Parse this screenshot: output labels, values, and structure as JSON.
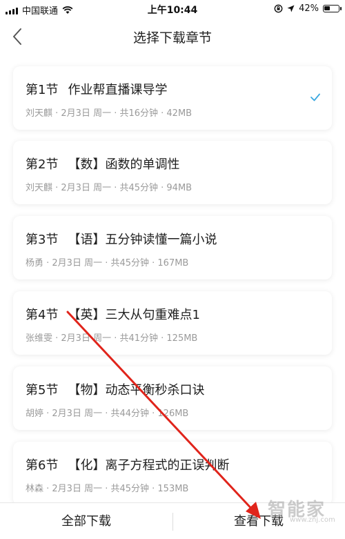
{
  "status_bar": {
    "carrier": "中国联通",
    "time": "上午10:44",
    "battery": "42%",
    "battery_level": 0.42
  },
  "nav": {
    "title": "选择下载章节"
  },
  "chapters": [
    {
      "num": "第1节",
      "title": "作业帮直播课导学",
      "meta": "刘天麒 · 2月3日 周一 · 共16分钟 · 42MB",
      "selected": true
    },
    {
      "num": "第2节",
      "title": "【数】函数的单调性",
      "meta": "刘天麒 · 2月3日 周一 · 共45分钟 · 94MB",
      "selected": false
    },
    {
      "num": "第3节",
      "title": "【语】五分钟读懂一篇小说",
      "meta": "杨勇 · 2月3日 周一 · 共45分钟 · 167MB",
      "selected": false
    },
    {
      "num": "第4节",
      "title": "【英】三大从句重难点1",
      "meta": "张维雯 · 2月3日 周一 · 共41分钟 · 125MB",
      "selected": false
    },
    {
      "num": "第5节",
      "title": "【物】动态平衡秒杀口诀",
      "meta": "胡婷 · 2月3日 周一 · 共44分钟 · 126MB",
      "selected": false
    },
    {
      "num": "第6节",
      "title": "【化】离子方程式的正误判断",
      "meta": "林森 · 2月3日 周一 · 共45分钟 · 153MB",
      "selected": false
    }
  ],
  "bottom_bar": {
    "download_all": "全部下载",
    "view_downloads": "查看下载"
  },
  "watermark": {
    "text": "智能家",
    "url": "www.znj.com"
  },
  "colors": {
    "check": "#3aa8e0",
    "annotation_arrow": "#e0241b"
  }
}
